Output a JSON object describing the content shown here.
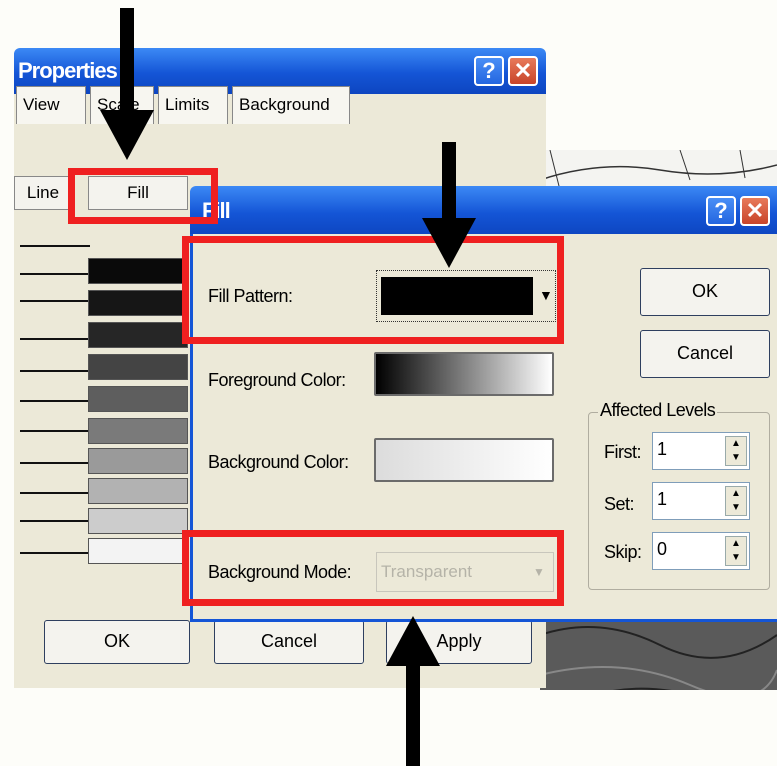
{
  "properties_window": {
    "title": "Properties",
    "tabs": [
      "View",
      "Scale",
      "Limits",
      "Background"
    ],
    "subtabs": {
      "line": "Line",
      "fill": "Fill"
    },
    "buttons": {
      "ok": "OK",
      "cancel": "Cancel",
      "apply": "Apply"
    }
  },
  "fill_dialog": {
    "title": "Fill",
    "fill_pattern_label": "Fill Pattern:",
    "foreground_color_label": "Foreground Color:",
    "background_color_label": "Background Color:",
    "background_mode_label": "Background Mode:",
    "background_mode_value": "Transparent",
    "ok_label": "OK",
    "cancel_label": "Cancel",
    "affected_levels": {
      "label": "Affected Levels",
      "first_label": "First:",
      "first_value": "1",
      "set_label": "Set:",
      "set_value": "1",
      "skip_label": "Skip:",
      "skip_value": "0"
    }
  },
  "icons": {
    "help": "help-icon",
    "close": "close-icon",
    "dropdown": "dropdown-arrow-icon",
    "spin": "spin-arrows-icon"
  },
  "colors": {
    "highlight": "#ef2020",
    "titlebar": "#1455d6",
    "dialog_bg": "#ece9d8"
  }
}
